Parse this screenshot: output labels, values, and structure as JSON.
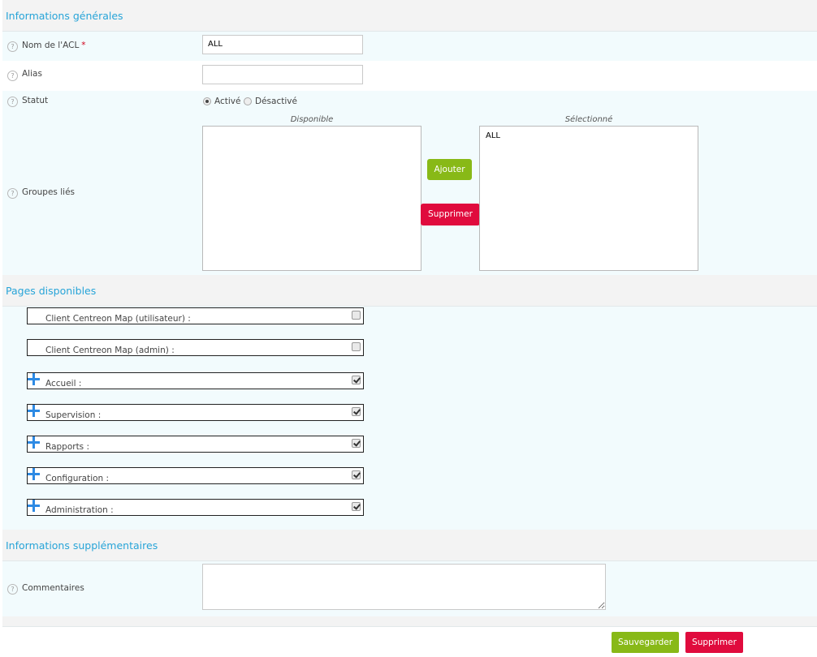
{
  "sections": {
    "general": "Informations générales",
    "pages": "Pages disponibles",
    "extra": "Informations supplémentaires"
  },
  "help_glyph": "?",
  "fields": {
    "acl_name": {
      "label": "Nom de l'ACL",
      "required_mark": "*",
      "value": "ALL"
    },
    "alias": {
      "label": "Alias",
      "value": ""
    },
    "status": {
      "label": "Statut",
      "options": [
        "Activé",
        "Désactivé"
      ],
      "selected": "Activé"
    },
    "linked_groups": {
      "label": "Groupes liés",
      "available_caption": "Disponible",
      "selected_caption": "Sélectionné",
      "available_items": [],
      "selected_items": [
        "ALL"
      ],
      "add_label": "Ajouter",
      "remove_label": "Supprimer"
    },
    "comments": {
      "label": "Commentaires",
      "value": ""
    }
  },
  "pages": [
    {
      "label": "Client Centreon Map (utilisateur) :",
      "expandable": false,
      "checked": false
    },
    {
      "label": "Client Centreon Map (admin) :",
      "expandable": false,
      "checked": false
    },
    {
      "label": "Accueil :",
      "expandable": true,
      "checked": true
    },
    {
      "label": "Supervision :",
      "expandable": true,
      "checked": true
    },
    {
      "label": "Rapports :",
      "expandable": true,
      "checked": true
    },
    {
      "label": "Configuration :",
      "expandable": true,
      "checked": true
    },
    {
      "label": "Administration :",
      "expandable": true,
      "checked": true
    }
  ],
  "footer": {
    "save_label": "Sauvegarder",
    "delete_label": "Supprimer"
  },
  "colors": {
    "accent": "#27a4d8",
    "save": "#88b917",
    "delete": "#e00b3d",
    "row_light": "#f2fbfd",
    "plus_icon": "#2d8ae4"
  }
}
